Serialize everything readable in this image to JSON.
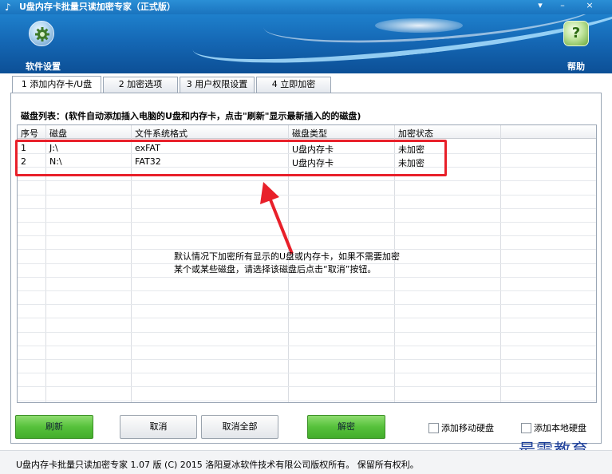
{
  "window": {
    "title": "U盘内存卡批量只读加密专家（正式版）",
    "controls": {
      "dropdown": "▾",
      "minimize": "–",
      "close": "×"
    }
  },
  "toolbar": {
    "settings_label": "软件设置",
    "help_label": "帮助",
    "help_icon_glyph": "?"
  },
  "tabs": [
    {
      "label": "1 添加内存卡/U盘",
      "active": true
    },
    {
      "label": "2 加密选项",
      "active": false
    },
    {
      "label": "3 用户权限设置",
      "active": false
    },
    {
      "label": "4 立即加密",
      "active": false
    }
  ],
  "disk_list": {
    "label": "磁盘列表：(软件自动添加插入电脑的U盘和内存卡，点击\"刷新\"显示最新插入的的磁盘)",
    "columns": [
      "序号",
      "磁盘",
      "文件系统格式",
      "磁盘类型",
      "加密状态"
    ],
    "rows": [
      [
        "1",
        "J:\\",
        "exFAT",
        "U盘内存卡",
        "未加密"
      ],
      [
        "2",
        "N:\\",
        "FAT32",
        "U盘内存卡",
        "未加密"
      ]
    ]
  },
  "annotation": {
    "line1": "默认情况下加密所有显示的U盘或内存卡，如果不需要加密",
    "line2": "某个或某些磁盘，请选择该磁盘后点击“取消”按钮。",
    "color": "#e8202a"
  },
  "buttons": {
    "refresh": "刷新",
    "cancel": "取消",
    "cancel_all": "取消全部",
    "decrypt": "解密"
  },
  "checkboxes": {
    "add_mobile_disk": {
      "label": "添加移动硬盘",
      "checked": false
    },
    "add_local_disk": {
      "label": "添加本地硬盘",
      "checked": false
    }
  },
  "watermark": "最需教育",
  "status_bar": "U盘内存卡批量只读加密专家 1.07 版 (C) 2015 洛阳夏冰软件技术有限公司版权所有。 保留所有权利。",
  "colors": {
    "accent_blue": "#1a73be",
    "button_green": "#56c13b",
    "highlight_red": "#e8202a"
  }
}
